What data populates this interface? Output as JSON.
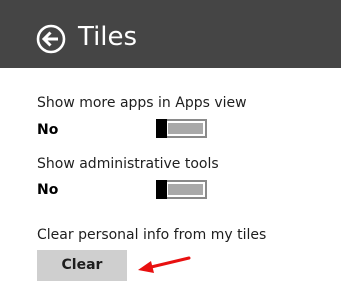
{
  "header": {
    "title": "Tiles",
    "back_icon": "back-arrow-circle-icon",
    "background_color": "#454545"
  },
  "settings": {
    "show_more_apps": {
      "label": "Show more apps in Apps view",
      "state": "No",
      "enabled": false
    },
    "show_admin_tools": {
      "label": "Show administrative tools",
      "state": "No",
      "enabled": false
    },
    "clear_info": {
      "label": "Clear personal info from my tiles",
      "button_label": "Clear"
    }
  },
  "annotation": {
    "icon": "red-arrow-icon",
    "color": "#e81010"
  }
}
